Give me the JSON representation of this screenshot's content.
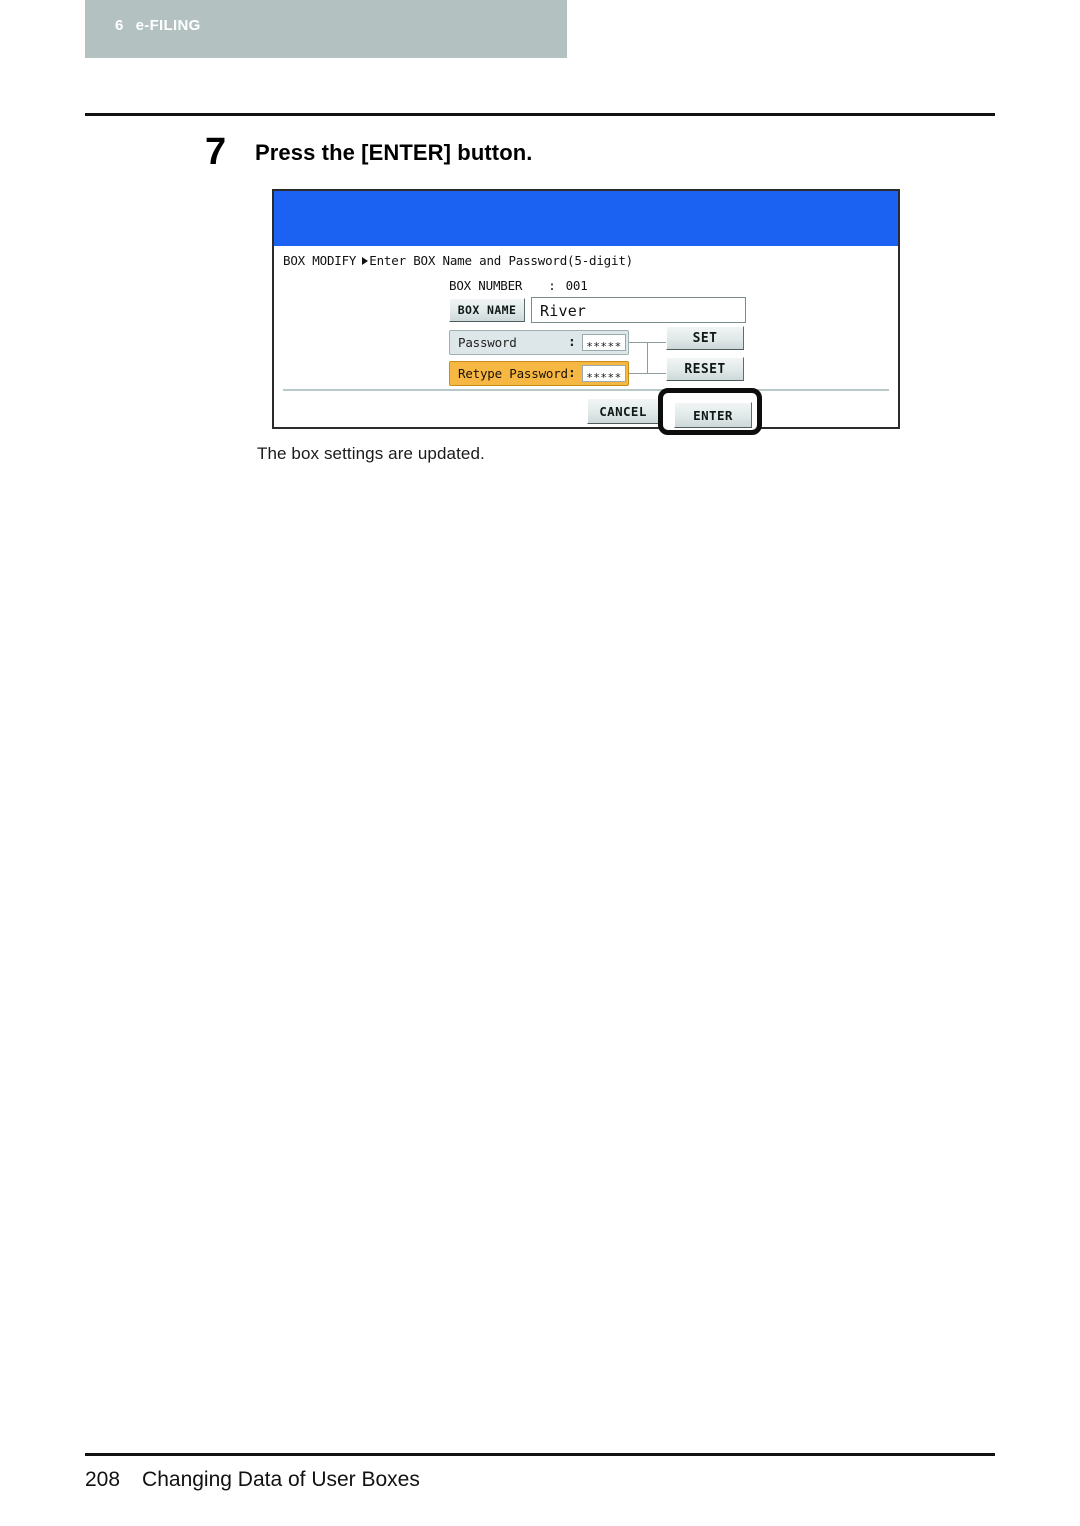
{
  "header": {
    "chapter_number": "6",
    "chapter_title": "e-FILING"
  },
  "step": {
    "number": "7",
    "title": "Press the [ENTER] button."
  },
  "lcd_panel": {
    "breadcrumb_prefix": "BOX MODIFY",
    "breadcrumb_current": "Enter BOX Name and Password(5-digit)",
    "box_number_label": "BOX NUMBER",
    "box_number_colon": ":",
    "box_number_value": "001",
    "box_name_button": "BOX NAME",
    "box_name_value": "River",
    "password_label": "Password",
    "password_colon": ":",
    "password_value": "∗∗∗∗∗",
    "retype_label": "Retype Password",
    "retype_colon": ":",
    "retype_value": "∗∗∗∗∗",
    "set_button": "SET",
    "reset_button": "RESET",
    "cancel_button": "CANCEL",
    "enter_button": "ENTER",
    "titlebar_color": "#1c62f2",
    "active_row_color": "#f6b842",
    "inactive_row_color": "#dde6e8"
  },
  "caption": "The box settings are updated.",
  "footer": {
    "page_number": "208",
    "section_title": "Changing Data of User Boxes"
  }
}
